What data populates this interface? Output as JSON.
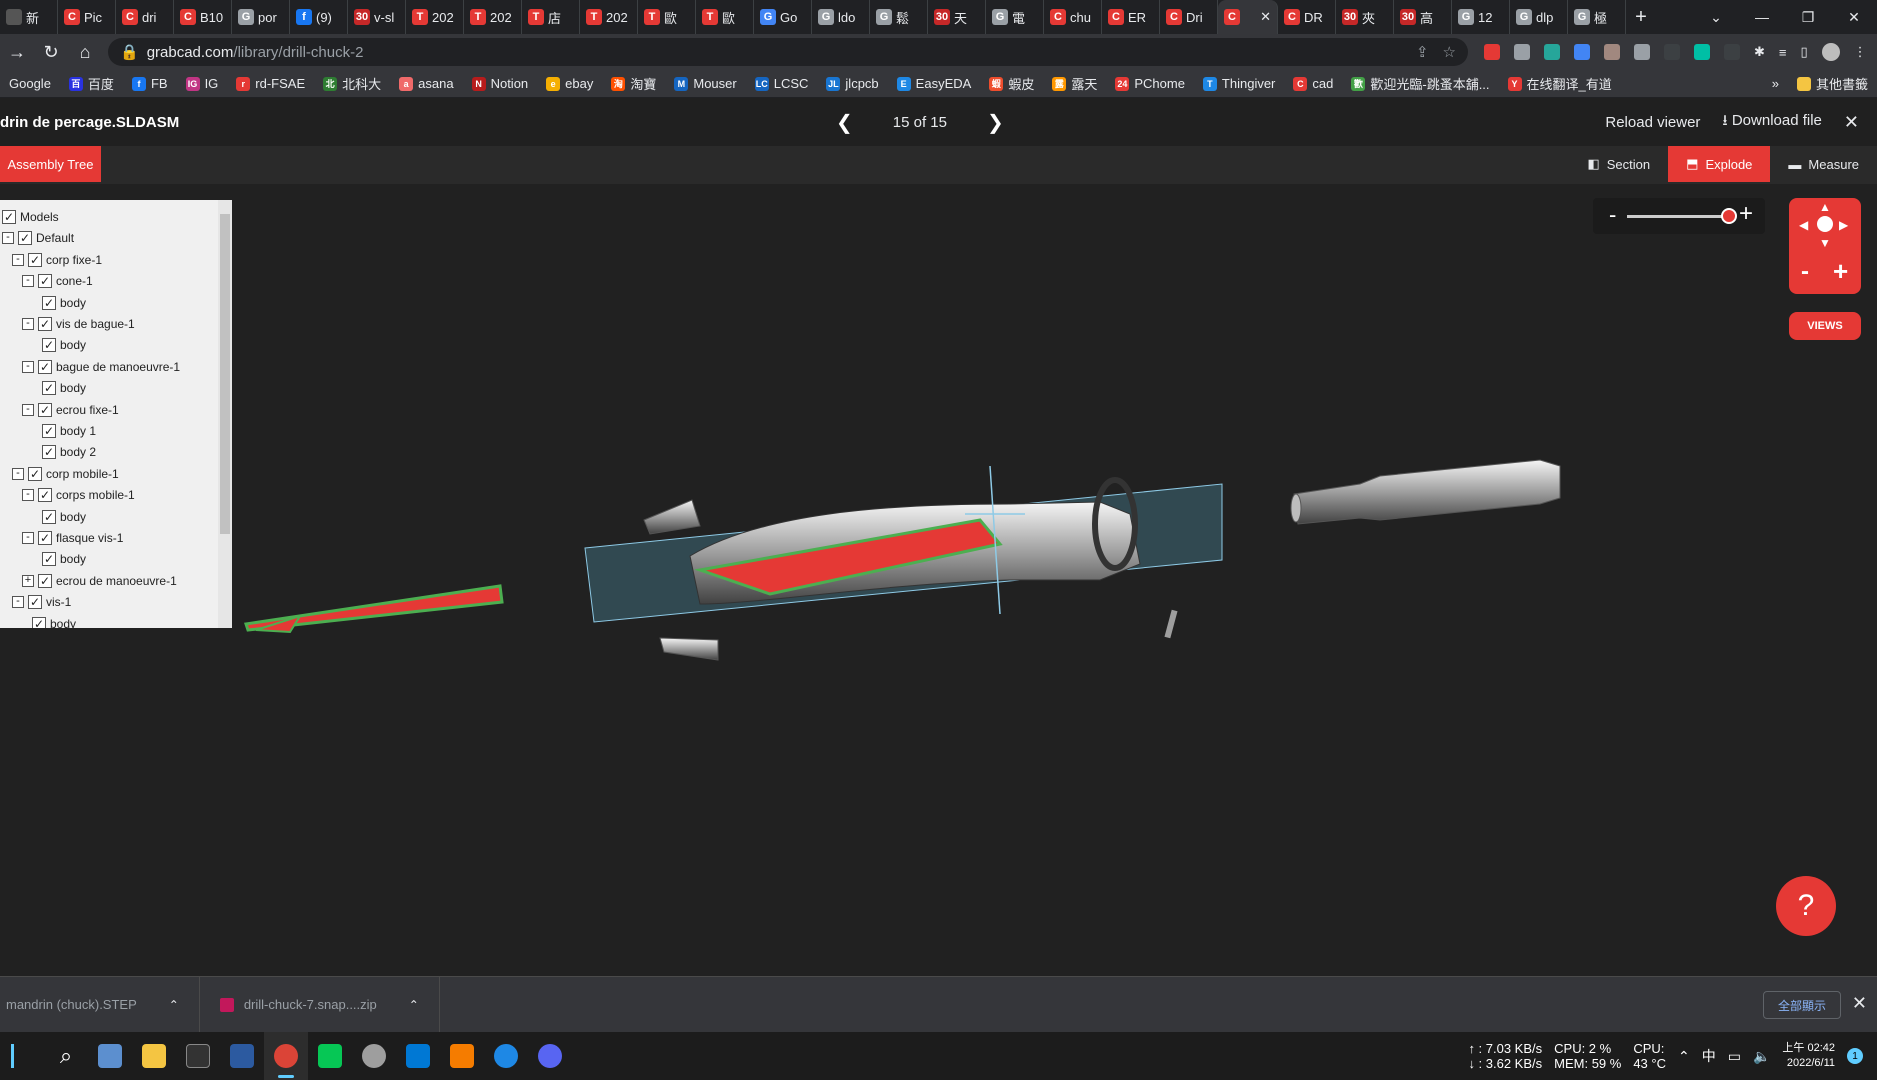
{
  "browser": {
    "tabs": [
      {
        "label": "新",
        "color": "#555555",
        "glyph": ""
      },
      {
        "label": "Pic",
        "color": "#e53935",
        "glyph": "C"
      },
      {
        "label": "dri",
        "color": "#e53935",
        "glyph": "C"
      },
      {
        "label": "B10",
        "color": "#e53935",
        "glyph": "C"
      },
      {
        "label": "por",
        "color": "#9aa0a6",
        "glyph": "G"
      },
      {
        "label": "(9)",
        "color": "#1877f2",
        "glyph": "f"
      },
      {
        "label": "v-sl",
        "color": "#c62828",
        "glyph": "30"
      },
      {
        "label": "202",
        "color": "#e53935",
        "glyph": "T"
      },
      {
        "label": "202",
        "color": "#e53935",
        "glyph": "T"
      },
      {
        "label": "店",
        "color": "#e53935",
        "glyph": "T"
      },
      {
        "label": "202",
        "color": "#e53935",
        "glyph": "T"
      },
      {
        "label": "歐",
        "color": "#e53935",
        "glyph": "T"
      },
      {
        "label": "歐",
        "color": "#e53935",
        "glyph": "T"
      },
      {
        "label": "Go",
        "color": "#4285f4",
        "glyph": "G"
      },
      {
        "label": "ldo",
        "color": "#9aa0a6",
        "glyph": "G"
      },
      {
        "label": "鬆",
        "color": "#9aa0a6",
        "glyph": "G"
      },
      {
        "label": "天",
        "color": "#c62828",
        "glyph": "30"
      },
      {
        "label": "電",
        "color": "#9aa0a6",
        "glyph": "G"
      },
      {
        "label": "chu",
        "color": "#e53935",
        "glyph": "C"
      },
      {
        "label": "ER",
        "color": "#e53935",
        "glyph": "C"
      },
      {
        "label": "Dri",
        "color": "#e53935",
        "glyph": "C"
      },
      {
        "label": "",
        "color": "#e53935",
        "glyph": "C",
        "active": true
      },
      {
        "label": "DR",
        "color": "#e53935",
        "glyph": "C"
      },
      {
        "label": "夾",
        "color": "#c62828",
        "glyph": "30"
      },
      {
        "label": "高",
        "color": "#c62828",
        "glyph": "30"
      },
      {
        "label": "12",
        "color": "#9aa0a6",
        "glyph": "G"
      },
      {
        "label": "dlp",
        "color": "#9aa0a6",
        "glyph": "G"
      },
      {
        "label": "極",
        "color": "#9aa0a6",
        "glyph": "G"
      }
    ],
    "new_tab": "+",
    "url_host": "grabcad.com",
    "url_path": "/library/drill-chuck-2",
    "bookmarks": [
      {
        "label": "Google",
        "color": "#4285f4",
        "glyph": ""
      },
      {
        "label": "百度",
        "color": "#2932e1",
        "glyph": "百"
      },
      {
        "label": "FB",
        "color": "#1877f2",
        "glyph": "f"
      },
      {
        "label": "IG",
        "color": "#c13584",
        "glyph": "IG"
      },
      {
        "label": "rd-FSAE",
        "color": "#e53935",
        "glyph": "r"
      },
      {
        "label": "北科大",
        "color": "#2e7d32",
        "glyph": "北"
      },
      {
        "label": "asana",
        "color": "#f06a6a",
        "glyph": "a"
      },
      {
        "label": "Notion",
        "color": "#b71c1c",
        "glyph": "N"
      },
      {
        "label": "ebay",
        "color": "#f5af02",
        "glyph": "e"
      },
      {
        "label": "淘寶",
        "color": "#ff5000",
        "glyph": "淘"
      },
      {
        "label": "Mouser",
        "color": "#1565c0",
        "glyph": "M"
      },
      {
        "label": "LCSC",
        "color": "#1565c0",
        "glyph": "LC"
      },
      {
        "label": "jlcpcb",
        "color": "#1976d2",
        "glyph": "JL"
      },
      {
        "label": "EasyEDA",
        "color": "#1e88e5",
        "glyph": "E"
      },
      {
        "label": "蝦皮",
        "color": "#ee4d2d",
        "glyph": "蝦"
      },
      {
        "label": "露天",
        "color": "#ff9800",
        "glyph": "露"
      },
      {
        "label": "PChome",
        "color": "#e53935",
        "glyph": "24"
      },
      {
        "label": "Thingiver",
        "color": "#1e88e5",
        "glyph": "T"
      },
      {
        "label": "cad",
        "color": "#e53935",
        "glyph": "C"
      },
      {
        "label": "歡迎光臨-跳蚤本舖...",
        "color": "#43a047",
        "glyph": "歡"
      },
      {
        "label": "在线翻译_有道",
        "color": "#e53935",
        "glyph": "Y"
      }
    ],
    "bookmarks_more": "»",
    "other_bookmarks": "其他書籤"
  },
  "viewer": {
    "file_name": "drin de percage.SLDASM",
    "pager": "15 of 15",
    "reload": "Reload viewer",
    "download": "Download file",
    "assembly_tree_btn": "Assembly Tree",
    "section": "Section",
    "explode": "Explode",
    "measure": "Measure",
    "views": "VIEWS",
    "help": "?",
    "zoom_minus": "-",
    "zoom_plus": "+",
    "zoom_level": 0.92,
    "nav_minus": "-",
    "nav_plus": "+"
  },
  "tree": [
    {
      "label": "Models",
      "exp": "",
      "checked": true
    },
    {
      "label": "Default",
      "exp": "-",
      "checked": true
    },
    {
      "label": "corp fixe-1",
      "exp": "-",
      "checked": true
    },
    {
      "label": "cone-1",
      "exp": "-",
      "checked": true
    },
    {
      "label": "body",
      "exp": "",
      "checked": true
    },
    {
      "label": "vis de bague-1",
      "exp": "-",
      "checked": true
    },
    {
      "label": "body",
      "exp": "",
      "checked": true
    },
    {
      "label": "bague de manoeuvre-1",
      "exp": "-",
      "checked": true
    },
    {
      "label": "body",
      "exp": "",
      "checked": true
    },
    {
      "label": "ecrou fixe-1",
      "exp": "-",
      "checked": true
    },
    {
      "label": "body 1",
      "exp": "",
      "checked": true
    },
    {
      "label": "body 2",
      "exp": "",
      "checked": true
    },
    {
      "label": "corp mobile-1",
      "exp": "-",
      "checked": true
    },
    {
      "label": "corps mobile-1",
      "exp": "-",
      "checked": true
    },
    {
      "label": "body",
      "exp": "",
      "checked": true
    },
    {
      "label": "flasque vis-1",
      "exp": "-",
      "checked": true
    },
    {
      "label": "body",
      "exp": "",
      "checked": true
    },
    {
      "label": "ecrou de manoeuvre-1",
      "exp": "+",
      "checked": true
    },
    {
      "label": "vis-1",
      "exp": "-",
      "checked": true
    },
    {
      "label": "body",
      "exp": "",
      "checked": true
    }
  ],
  "downloads": [
    {
      "label": "mandrin (chuck).STEP"
    },
    {
      "label": "drill-chuck-7.snap....zip"
    }
  ],
  "downloads_show_all": "全部顯示",
  "taskbar": {
    "net_up": "↑ : 7.03 KB/s",
    "net_down": "↓ : 3.62 KB/s",
    "cpu": "CPU: 2 %",
    "mem": "MEM: 59 %",
    "cpu_temp_label": "CPU:",
    "cpu_temp": "43 °C",
    "ime": "中",
    "time": "上午 02:42",
    "date": "2022/6/11",
    "notif": "1"
  }
}
